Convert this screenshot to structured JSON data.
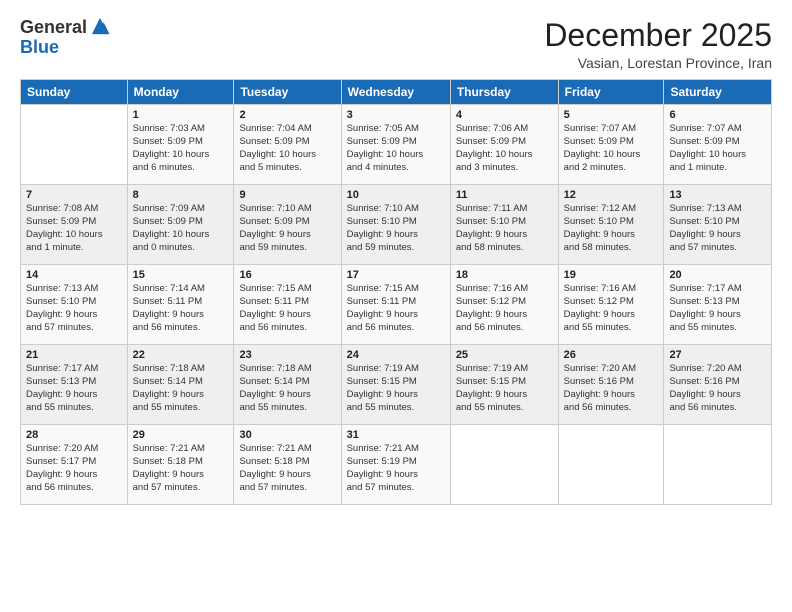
{
  "logo": {
    "general": "General",
    "blue": "Blue"
  },
  "header": {
    "month": "December 2025",
    "subtitle": "Vasian, Lorestan Province, Iran"
  },
  "weekdays": [
    "Sunday",
    "Monday",
    "Tuesday",
    "Wednesday",
    "Thursday",
    "Friday",
    "Saturday"
  ],
  "weeks": [
    [
      {
        "day": "",
        "info": ""
      },
      {
        "day": "1",
        "info": "Sunrise: 7:03 AM\nSunset: 5:09 PM\nDaylight: 10 hours\nand 6 minutes."
      },
      {
        "day": "2",
        "info": "Sunrise: 7:04 AM\nSunset: 5:09 PM\nDaylight: 10 hours\nand 5 minutes."
      },
      {
        "day": "3",
        "info": "Sunrise: 7:05 AM\nSunset: 5:09 PM\nDaylight: 10 hours\nand 4 minutes."
      },
      {
        "day": "4",
        "info": "Sunrise: 7:06 AM\nSunset: 5:09 PM\nDaylight: 10 hours\nand 3 minutes."
      },
      {
        "day": "5",
        "info": "Sunrise: 7:07 AM\nSunset: 5:09 PM\nDaylight: 10 hours\nand 2 minutes."
      },
      {
        "day": "6",
        "info": "Sunrise: 7:07 AM\nSunset: 5:09 PM\nDaylight: 10 hours\nand 1 minute."
      }
    ],
    [
      {
        "day": "7",
        "info": "Sunrise: 7:08 AM\nSunset: 5:09 PM\nDaylight: 10 hours\nand 1 minute."
      },
      {
        "day": "8",
        "info": "Sunrise: 7:09 AM\nSunset: 5:09 PM\nDaylight: 10 hours\nand 0 minutes."
      },
      {
        "day": "9",
        "info": "Sunrise: 7:10 AM\nSunset: 5:09 PM\nDaylight: 9 hours\nand 59 minutes."
      },
      {
        "day": "10",
        "info": "Sunrise: 7:10 AM\nSunset: 5:10 PM\nDaylight: 9 hours\nand 59 minutes."
      },
      {
        "day": "11",
        "info": "Sunrise: 7:11 AM\nSunset: 5:10 PM\nDaylight: 9 hours\nand 58 minutes."
      },
      {
        "day": "12",
        "info": "Sunrise: 7:12 AM\nSunset: 5:10 PM\nDaylight: 9 hours\nand 58 minutes."
      },
      {
        "day": "13",
        "info": "Sunrise: 7:13 AM\nSunset: 5:10 PM\nDaylight: 9 hours\nand 57 minutes."
      }
    ],
    [
      {
        "day": "14",
        "info": "Sunrise: 7:13 AM\nSunset: 5:10 PM\nDaylight: 9 hours\nand 57 minutes."
      },
      {
        "day": "15",
        "info": "Sunrise: 7:14 AM\nSunset: 5:11 PM\nDaylight: 9 hours\nand 56 minutes."
      },
      {
        "day": "16",
        "info": "Sunrise: 7:15 AM\nSunset: 5:11 PM\nDaylight: 9 hours\nand 56 minutes."
      },
      {
        "day": "17",
        "info": "Sunrise: 7:15 AM\nSunset: 5:11 PM\nDaylight: 9 hours\nand 56 minutes."
      },
      {
        "day": "18",
        "info": "Sunrise: 7:16 AM\nSunset: 5:12 PM\nDaylight: 9 hours\nand 56 minutes."
      },
      {
        "day": "19",
        "info": "Sunrise: 7:16 AM\nSunset: 5:12 PM\nDaylight: 9 hours\nand 55 minutes."
      },
      {
        "day": "20",
        "info": "Sunrise: 7:17 AM\nSunset: 5:13 PM\nDaylight: 9 hours\nand 55 minutes."
      }
    ],
    [
      {
        "day": "21",
        "info": "Sunrise: 7:17 AM\nSunset: 5:13 PM\nDaylight: 9 hours\nand 55 minutes."
      },
      {
        "day": "22",
        "info": "Sunrise: 7:18 AM\nSunset: 5:14 PM\nDaylight: 9 hours\nand 55 minutes."
      },
      {
        "day": "23",
        "info": "Sunrise: 7:18 AM\nSunset: 5:14 PM\nDaylight: 9 hours\nand 55 minutes."
      },
      {
        "day": "24",
        "info": "Sunrise: 7:19 AM\nSunset: 5:15 PM\nDaylight: 9 hours\nand 55 minutes."
      },
      {
        "day": "25",
        "info": "Sunrise: 7:19 AM\nSunset: 5:15 PM\nDaylight: 9 hours\nand 55 minutes."
      },
      {
        "day": "26",
        "info": "Sunrise: 7:20 AM\nSunset: 5:16 PM\nDaylight: 9 hours\nand 56 minutes."
      },
      {
        "day": "27",
        "info": "Sunrise: 7:20 AM\nSunset: 5:16 PM\nDaylight: 9 hours\nand 56 minutes."
      }
    ],
    [
      {
        "day": "28",
        "info": "Sunrise: 7:20 AM\nSunset: 5:17 PM\nDaylight: 9 hours\nand 56 minutes."
      },
      {
        "day": "29",
        "info": "Sunrise: 7:21 AM\nSunset: 5:18 PM\nDaylight: 9 hours\nand 57 minutes."
      },
      {
        "day": "30",
        "info": "Sunrise: 7:21 AM\nSunset: 5:18 PM\nDaylight: 9 hours\nand 57 minutes."
      },
      {
        "day": "31",
        "info": "Sunrise: 7:21 AM\nSunset: 5:19 PM\nDaylight: 9 hours\nand 57 minutes."
      },
      {
        "day": "",
        "info": ""
      },
      {
        "day": "",
        "info": ""
      },
      {
        "day": "",
        "info": ""
      }
    ]
  ]
}
